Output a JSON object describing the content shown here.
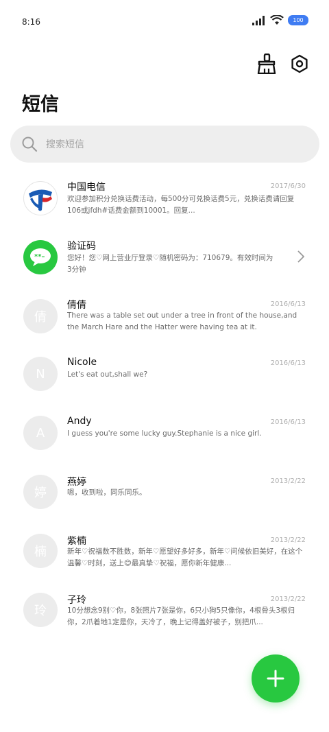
{
  "status_bar": {
    "time": "8:16",
    "battery_level": "100"
  },
  "title": "短信",
  "search": {
    "placeholder": "搜索短信"
  },
  "conversations": [
    {
      "name": "中国电信",
      "date": "2017/6/30",
      "preview": "欢迎参加积分兑换话费活动，每500分可兑换话费5元，兑换话费请回复106或jfdh#话费金额到10001。回复...",
      "avatar": "china-telecom-logo"
    },
    {
      "name": "验证码",
      "date": "",
      "preview": "您好！您♡网上营业厅登录♡随机密码为：710679。有效时间为3分钟",
      "avatar": "message-bubble-icon"
    },
    {
      "name": "倩倩",
      "date": "2016/6/13",
      "preview": "There was a table set out under a tree in front of the house,and the March Hare and the Hatter were having tea at it.",
      "avatar": "倩"
    },
    {
      "name": "Nicole",
      "date": "2016/6/13",
      "preview": "Let's eat out,shall we?",
      "avatar": "N"
    },
    {
      "name": "Andy",
      "date": "2016/6/13",
      "preview": "I guess you're some lucky guy.Stephanie is a nice girl.",
      "avatar": "A"
    },
    {
      "name": "燕婷",
      "date": "2013/2/22",
      "preview": "嗯，收到啦，同乐同乐。",
      "avatar": "婷"
    },
    {
      "name": "紫楠",
      "date": "2013/2/22",
      "preview": "新年♡祝福数不胜数，新年♡愿望好多好多，新年♡问候依旧美好，在这个温馨♡时刻，送上😊最真挚♡祝福，愿你新年健康...",
      "avatar": "楠"
    },
    {
      "name": "子玲",
      "date": "2013/2/22",
      "preview": "10分想念9别♡你，8张照片7张是你，6只小狗5只像你，4根骨头3根归你，2爪着地1定是你，天冷了，晚上记得盖好被子，别把爪...",
      "avatar": "玲"
    }
  ],
  "colors": {
    "accent": "#28c840",
    "battery": "#3f7cf2"
  },
  "icons": {
    "toolbar_left": "broom-icon",
    "toolbar_right": "settings-icon",
    "fab": "plus-icon"
  }
}
